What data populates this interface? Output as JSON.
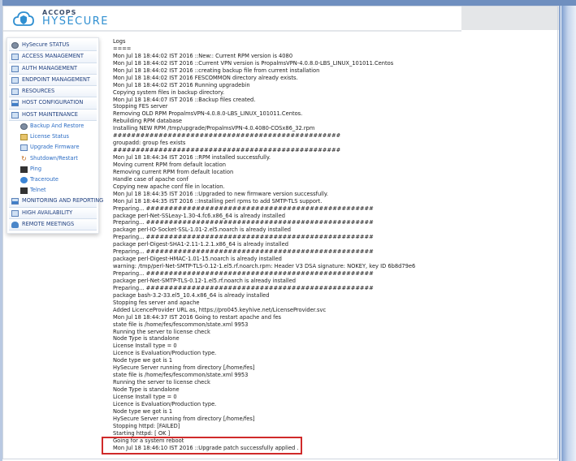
{
  "brand": {
    "name_small": "ACCOPS",
    "name_big": "HYSECURE"
  },
  "sidebar": {
    "items": [
      {
        "label": "HySecure STATUS",
        "icon": "status-icon",
        "sub": false
      },
      {
        "label": "ACCESS MANAGEMENT",
        "icon": "access-icon",
        "sub": false
      },
      {
        "label": "AUTH MANAGEMENT",
        "icon": "auth-icon",
        "sub": false
      },
      {
        "label": "ENDPOINT MANAGEMENT",
        "icon": "endpoint-icon",
        "sub": false
      },
      {
        "label": "RESOURCES",
        "icon": "resources-icon",
        "sub": false
      },
      {
        "label": "HOST CONFIGURATION",
        "icon": "host-config-icon",
        "sub": false
      },
      {
        "label": "HOST MAINTENANCE",
        "icon": "host-maintenance-icon",
        "sub": false
      },
      {
        "label": "Backup And Restore",
        "icon": "backup-icon",
        "sub": true
      },
      {
        "label": "License Status",
        "icon": "license-icon",
        "sub": true
      },
      {
        "label": "Upgrade Firmware",
        "icon": "upgrade-icon",
        "sub": true
      },
      {
        "label": "Shutdown/Restart",
        "icon": "shutdown-icon",
        "sub": true
      },
      {
        "label": "Ping",
        "icon": "ping-icon",
        "sub": true
      },
      {
        "label": "Traceroute",
        "icon": "traceroute-icon",
        "sub": true
      },
      {
        "label": "Telnet",
        "icon": "telnet-icon",
        "sub": true
      },
      {
        "label": "MONITORING AND REPORTING",
        "icon": "monitoring-icon",
        "sub": false
      },
      {
        "label": "HIGH AVAILABILITY",
        "icon": "ha-icon",
        "sub": false
      },
      {
        "label": "REMOTE MEETINGS",
        "icon": "meetings-icon",
        "sub": false
      }
    ]
  },
  "logs": {
    "lines": [
      "Logs",
      "====",
      "Mon Jul 18 18:44:02 IST 2016 ::New:: Current RPM version is 4080",
      "Mon Jul 18 18:44:02 IST 2016 ::Current VPN version is PropalmsVPN-4.0.8.0-LBS_LINUX_101011.Centos",
      "Mon Jul 18 18:44:02 IST 2016 ::creating backup file from current installation",
      "Mon Jul 18 18:44:02 IST 2016 FESCOMMON directory already exists.",
      "Mon Jul 18 18:44:02 IST 2016 Running upgradebin",
      "Copying system files in backup directory.",
      "Mon Jul 18 18:44:07 IST 2016 ::Backup files created.",
      "Stopping FES server",
      "Removing OLD RPM PropalmsVPN-4.0.8.0-LBS_LINUX_101011.Centos.",
      "Rebuilding RPM database",
      "Installing NEW RPM /tmp/upgrade/PropalmsVPN-4.0.4080-COSx86_32.rpm",
      "##################################################",
      "groupadd: group fes exists",
      "##################################################",
      "Mon Jul 18 18:44:34 IST 2016 ::RPM installed successfully.",
      "Moving current RPM from default location",
      "Removing current RPM from default location",
      "Handle case of apache conf",
      "Copying new apache conf file in location.",
      "Mon Jul 18 18:44:35 IST 2016 ::Upgraded to new firmware version successfully.",
      "Mon Jul 18 18:44:35 IST 2016 ::Installing perl rpms to add SMTP-TLS support.",
      "Preparing... ##################################################",
      "package perl-Net-SSLeay-1.30-4.fc6.x86_64 is already installed",
      "Preparing... ##################################################",
      "package perl-IO-Socket-SSL-1.01-2.el5.noarch is already installed",
      "Preparing... ##################################################",
      "package perl-Digest-SHA1-2.11-1.2.1.x86_64 is already installed",
      "Preparing... ##################################################",
      "package perl-Digest-HMAC-1.01-15.noarch is already installed",
      "warning: /tmp/perl-Net-SMTP-TLS-0.12-1.el5.rf.noarch.rpm: Header V3 DSA signature: NOKEY, key ID 6b8d79e6",
      "Preparing... ##################################################",
      "package perl-Net-SMTP-TLS-0.12-1.el5.rf.noarch is already installed",
      "Preparing... ##################################################",
      "package bash-3.2-33.el5_10.4.x86_64 is already installed",
      "Stopping fes server and apache",
      "Added LicenceProvider URL as, https://pro045.keyhive.net/LicenseProvider.svc",
      "Mon Jul 18 18:44:37 IST 2016 Going to restart apache and fes",
      "state file is /home/fes/fescommon/state.xml 9953",
      "Running the server to license check",
      "Node Type is standalone",
      "License Install type = 0",
      "Licence is Evaluation/Production type.",
      "Node type we got is 1",
      "HySecure Server running from directory [/home/fes]",
      "state file is /home/fes/fescommon/state.xml 9953",
      "Running the server to license check",
      "Node Type is standalone",
      "License Install type = 0",
      "Licence is Evaluation/Production type.",
      "Node type we got is 1",
      "HySecure Server running from directory [/home/fes]",
      "Stopping httpd: [FAILED]",
      "Starting httpd: [ OK ]",
      "Going for a system reboot",
      "Mon Jul 18 18:46:10 IST 2016 ::Upgrade patch successfully applied ."
    ]
  }
}
